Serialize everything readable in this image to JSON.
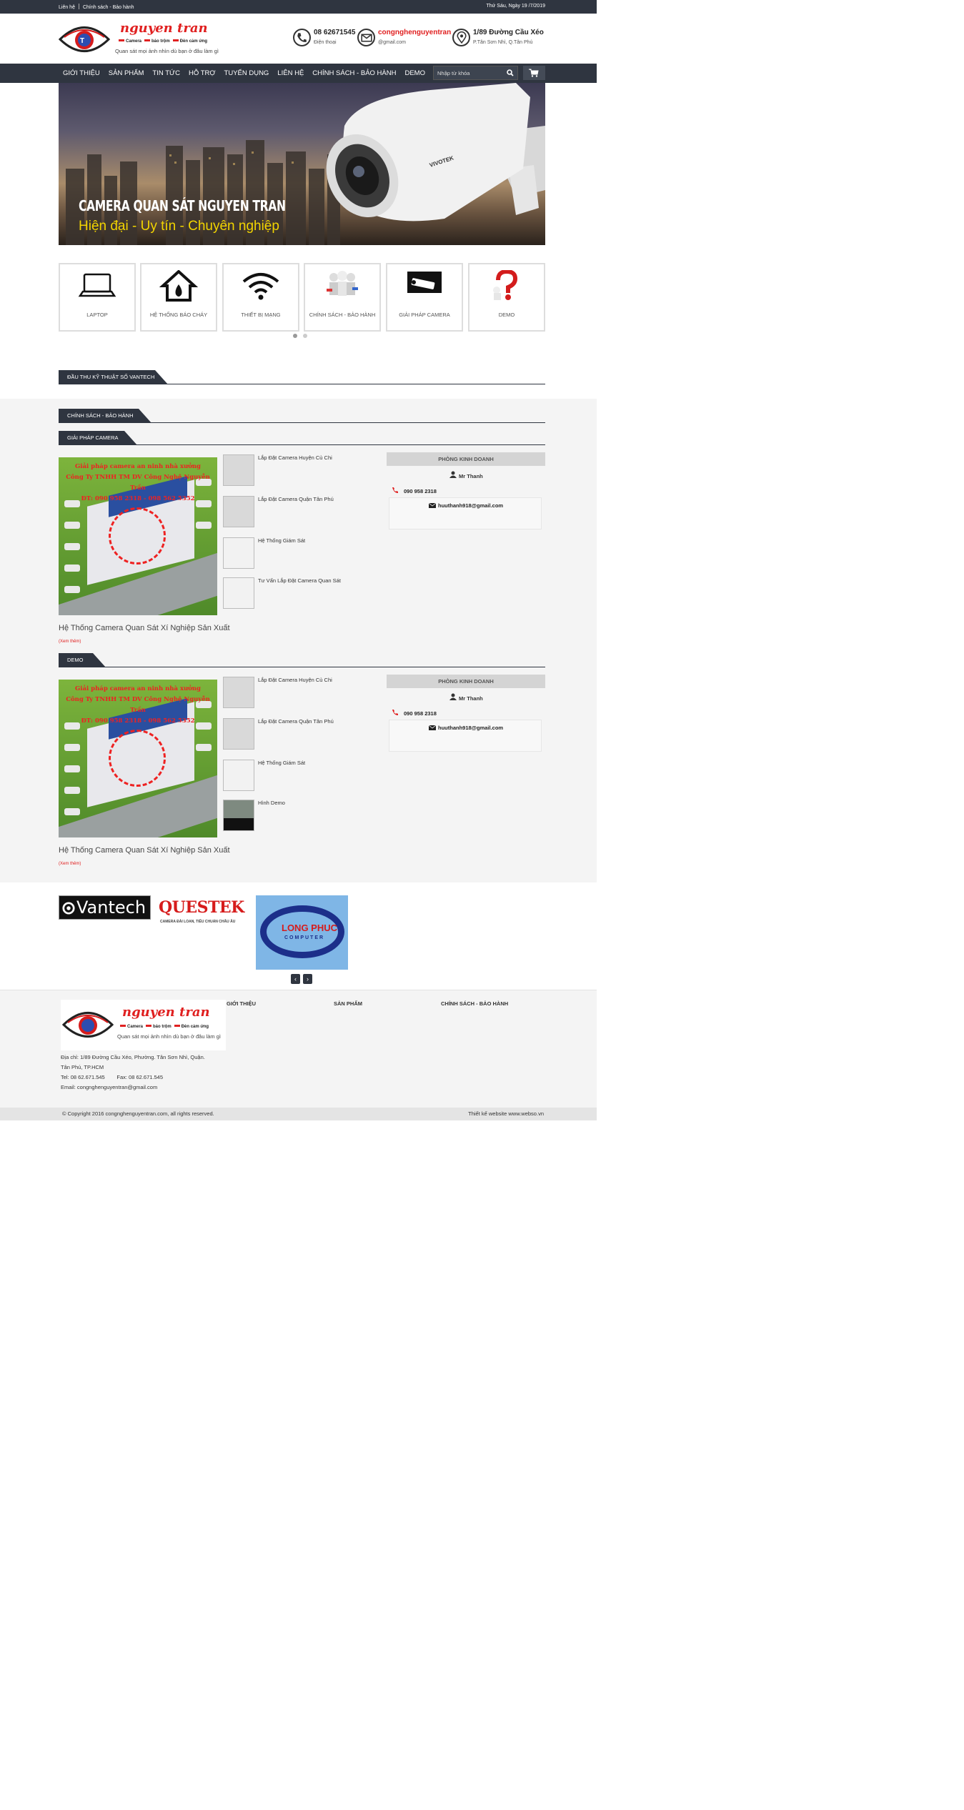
{
  "topbar": {
    "links": [
      "Liên hệ",
      "Chính sách - Bảo hành"
    ],
    "date": "Thứ Sáu, Ngày 19 /7/2019"
  },
  "logo": {
    "brand": "nguyen tran",
    "tags": [
      "Camera",
      "báo trộm",
      "Đèn cảm ứng"
    ],
    "slogan": "Quan sát mọi ảnh nhìn dù bạn ở đâu làm gì"
  },
  "header": {
    "phone": {
      "value": "08 62671545",
      "label": "Điện thoại"
    },
    "email": {
      "value": "congnghenguyentran",
      "label": "@gmail.com"
    },
    "address": {
      "value": "1/89 Đường Cầu Xéo",
      "label": "P.Tân Sơn Nhì, Q.Tân Phú"
    }
  },
  "nav": {
    "items": [
      "GIỚI THIỆU",
      "SẢN PHẨM",
      "TIN TỨC",
      "HỖ TRỢ",
      "TUYỂN DỤNG",
      "LIÊN HỆ",
      "CHÍNH SÁCH - BẢO HÀNH",
      "DEMO"
    ],
    "search_placeholder": "Nhập từ khóa"
  },
  "banner": {
    "title": "CAMERA QUAN SÁT NGUYEN TRAN",
    "subtitle": "Hiện đại - Uy tín - Chuyên nghiệp",
    "camera_brand": "VIVOTEK"
  },
  "categories": [
    {
      "label": "LAPTOP",
      "icon": "laptop-icon"
    },
    {
      "label": "HỆ THỐNG BÁO CHÁY",
      "icon": "fire-house-icon"
    },
    {
      "label": "THIẾT BỊ MẠNG",
      "icon": "wifi-icon"
    },
    {
      "label": "CHÍNH SÁCH - BẢO HÀNH",
      "icon": "team-icon"
    },
    {
      "label": "GIẢI PHÁP CAMERA",
      "icon": "camera-icon"
    },
    {
      "label": "DEMO",
      "icon": "question-icon"
    }
  ],
  "sections": {
    "vantech": "ĐẦU THU KỸ THUẬT SỐ VANTECH",
    "policy": "CHÍNH SÁCH - BẢO HÀNH",
    "solution": "GIẢI PHÁP CAMERA",
    "demo": "DEMO"
  },
  "block1": {
    "image_text": [
      "Giải pháp camera an ninh nhà xưởng",
      "Công Ty TNHH TM DV Công Nghệ Nguyễn Trần",
      "ĐT: 090 958 2318 - 098 562 5352"
    ],
    "title": "Hệ Thống Camera Quan Sát Xí Nghiệp Sản Xuất",
    "more": "(Xem thêm)",
    "related": [
      "Lắp Đặt Camera Huyện Củ Chi",
      "Lắp Đặt Camera Quận Tân Phú",
      "Hệ Thống Giám Sát",
      "Tư Vấn Lắp Đặt Camera Quan Sát"
    ]
  },
  "block2": {
    "image_text": [
      "Giải pháp camera an ninh nhà xưởng",
      "Công Ty TNHH TM DV Công Nghệ Nguyễn Trần",
      "ĐT: 090 958 2318 - 098 562 5352"
    ],
    "title": "Hệ Thống Camera Quan Sát Xí Nghiệp Sản Xuất",
    "more": "(Xem thêm)",
    "related": [
      "Lắp Đặt Camera Huyện Củ Chi",
      "Lắp Đặt Camera Quận Tân Phú",
      "Hệ Thống Giám Sát",
      "Hình Demo"
    ]
  },
  "contact": {
    "heading": "PHÒNG KINH DOANH",
    "name": "Mr Thanh",
    "phone": "090 958 2318",
    "email": "huuthanh918@gmail.com"
  },
  "partners": {
    "vantech": "Vantech",
    "questek": "QUESTEK",
    "questek_tag": "CAMERA ĐÀI LOAN, TIÊU CHUẨN CHÂU ÂU",
    "longphuc": "LONG PHUC",
    "longphuc_sub": "COMPUTER",
    "prev": "‹",
    "next": "›"
  },
  "footer": {
    "cols": [
      "GIỚI THIỆU",
      "SẢN PHẨM",
      "CHÍNH SÁCH - BẢO HÀNH"
    ],
    "address_lines": [
      "Địa chỉ: 1/89 Đường Cầu Xéo, Phường. Tân Sơn Nhì, Quận.",
      "Tân Phú, TP.HCM",
      "Tel: 08 62.671.545        Fax: 08 62.671.545",
      "Email: congnghenguyentran@gmail.com"
    ],
    "copyright": "© Copyright 2016 congnghenguyentran.com, all rights reserved.",
    "designer": "Thiết kế website www.webso.vn"
  },
  "colors": {
    "dark": "#2f3540",
    "accent": "#e02020",
    "banner_yellow": "#f2d400"
  }
}
